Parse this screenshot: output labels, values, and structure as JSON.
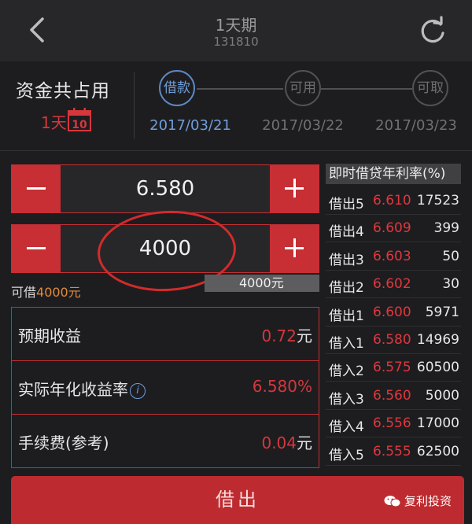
{
  "header": {
    "title": "1天期",
    "code": "131810"
  },
  "info": {
    "occupy_label": "资金共占用",
    "occupy_days": "1天",
    "calendar_day": "10",
    "timeline": [
      {
        "label": "借款",
        "date": "2017/03/21",
        "active": true
      },
      {
        "label": "可用",
        "date": "2017/03/22",
        "active": false
      },
      {
        "label": "可取",
        "date": "2017/03/23",
        "active": false
      }
    ]
  },
  "rate_input": {
    "value": "6.580"
  },
  "amount_input": {
    "value": "4000"
  },
  "available": {
    "prefix": "可借",
    "amount": "4000元",
    "badge": "4000元"
  },
  "summary": [
    {
      "label": "预期收益",
      "value": "0.72",
      "unit": "元"
    },
    {
      "label": "实际年化收益率",
      "value": "6.580%",
      "unit": ""
    },
    {
      "label": "手续费(参考)",
      "value": "0.04",
      "unit": "元"
    }
  ],
  "orderbook": {
    "title": "即时借贷年利率(%)",
    "rows": [
      {
        "label": "借出5",
        "rate": "6.610",
        "volume": "17523"
      },
      {
        "label": "借出4",
        "rate": "6.609",
        "volume": "399"
      },
      {
        "label": "借出3",
        "rate": "6.603",
        "volume": "50"
      },
      {
        "label": "借出2",
        "rate": "6.602",
        "volume": "30"
      },
      {
        "label": "借出1",
        "rate": "6.600",
        "volume": "5971"
      },
      {
        "label": "借入1",
        "rate": "6.580",
        "volume": "14969"
      },
      {
        "label": "借入2",
        "rate": "6.575",
        "volume": "60500"
      },
      {
        "label": "借入3",
        "rate": "6.560",
        "volume": "5000"
      },
      {
        "label": "借入4",
        "rate": "6.556",
        "volume": "17000"
      },
      {
        "label": "借入5",
        "rate": "6.555",
        "volume": "62500"
      }
    ]
  },
  "action": {
    "label": "借出"
  },
  "watermark": {
    "text": "复利投资"
  },
  "colors": {
    "accent_red": "#c72f35",
    "rate_red": "#e0373c",
    "active_blue": "#6f9ed9",
    "available_orange": "#e08a3a"
  },
  "icons": {
    "back": "chevron-left-icon",
    "refresh": "refresh-icon",
    "calendar": "calendar-icon",
    "info": "info-icon",
    "watermark": "wechat-icon"
  }
}
